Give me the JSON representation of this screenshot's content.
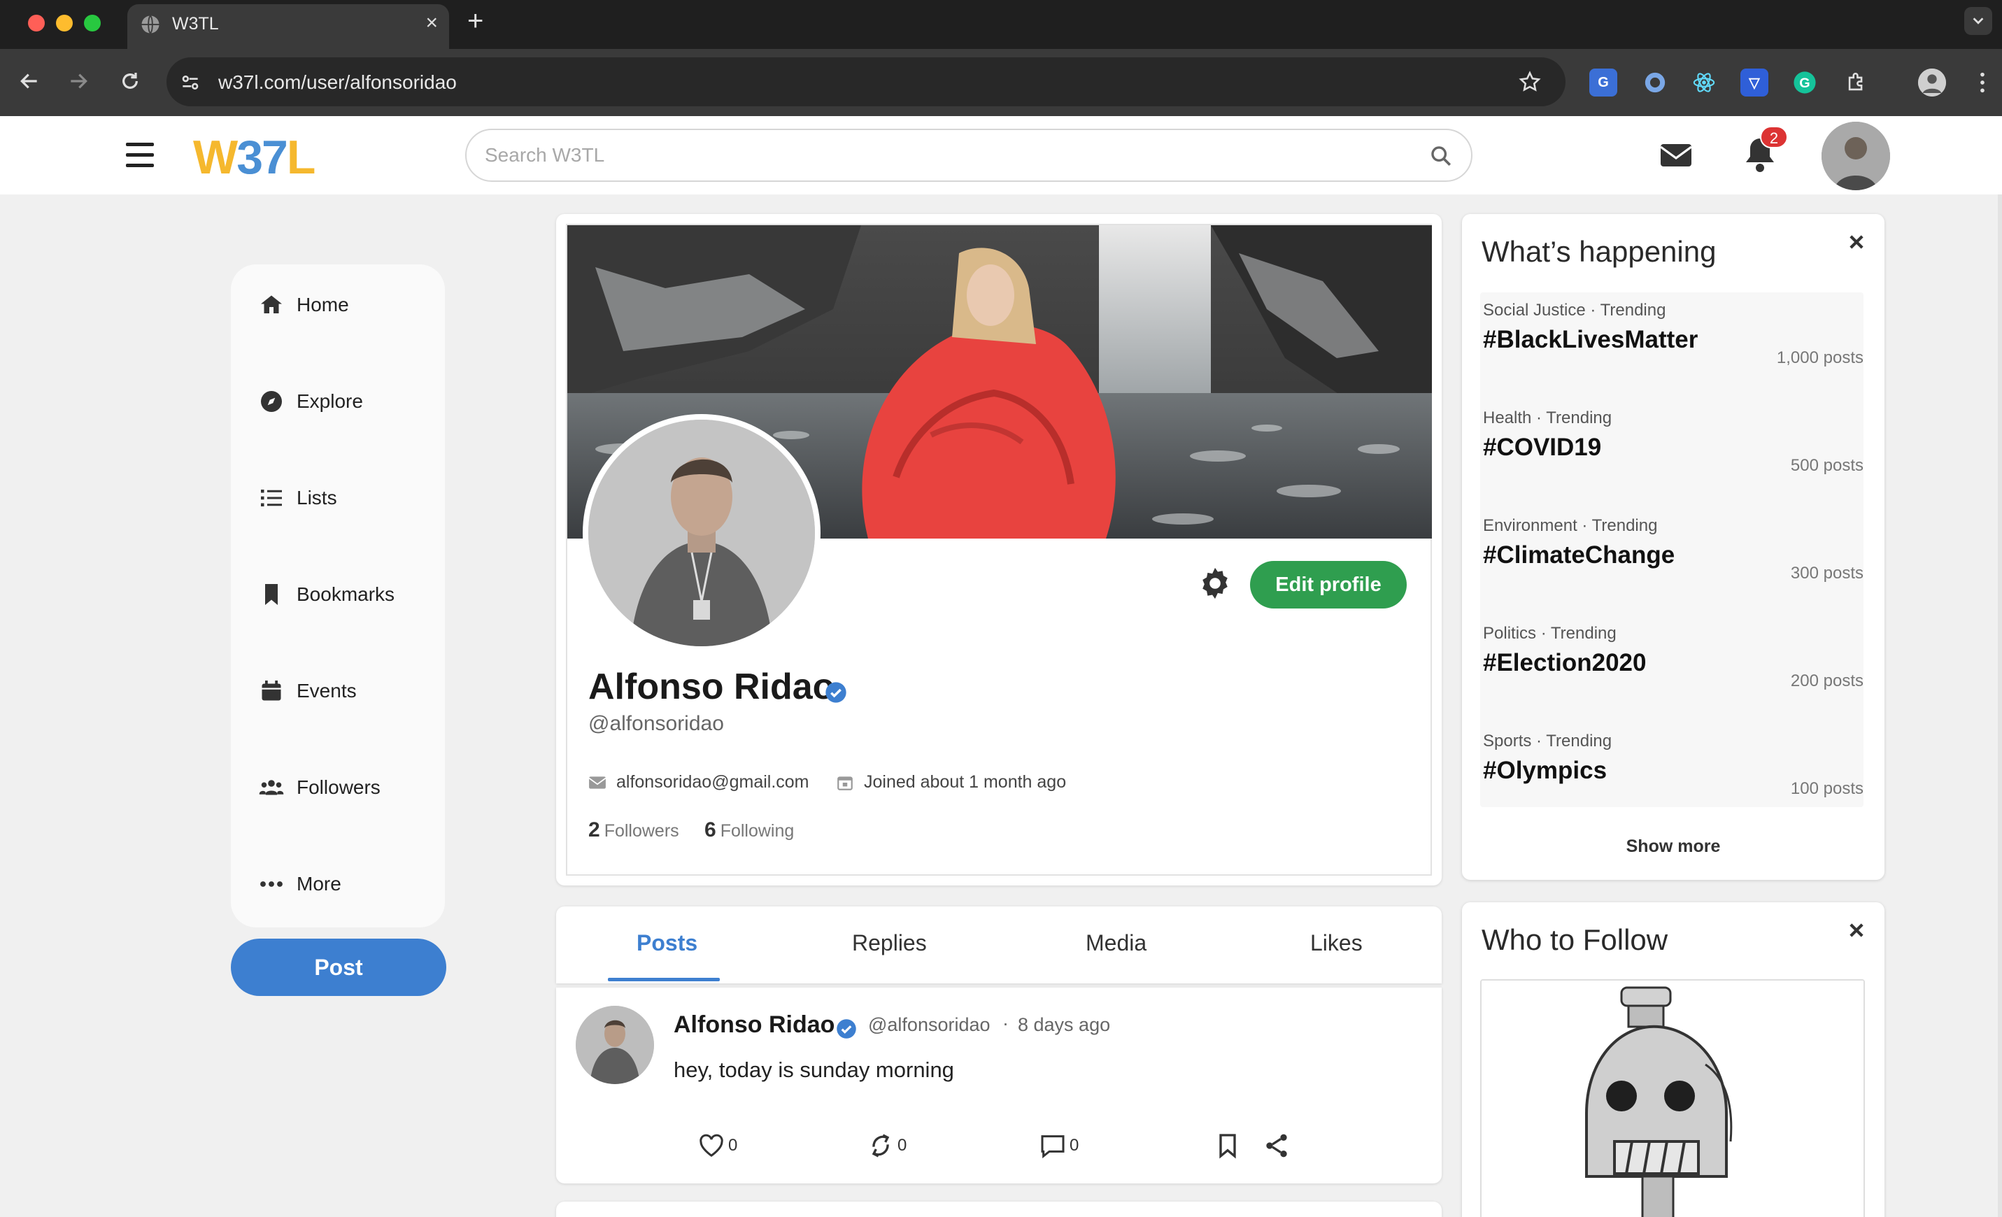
{
  "browser": {
    "tab_title": "W3TL",
    "url": "w37l.com/user/alfonsoridao"
  },
  "header": {
    "logo_w": "W",
    "logo_3": "37",
    "logo_l": "L",
    "search_placeholder": "Search W3TL",
    "notification_count": "2"
  },
  "sidebar": {
    "items": [
      {
        "label": "Home",
        "icon": "home-icon"
      },
      {
        "label": "Explore",
        "icon": "compass-icon"
      },
      {
        "label": "Lists",
        "icon": "list-icon"
      },
      {
        "label": "Bookmarks",
        "icon": "bookmark-icon"
      },
      {
        "label": "Events",
        "icon": "calendar-icon"
      },
      {
        "label": "Followers",
        "icon": "users-icon"
      },
      {
        "label": "More",
        "icon": "more-icon"
      }
    ],
    "post_label": "Post"
  },
  "profile": {
    "name": "Alfonso Ridao",
    "handle": "@alfonsoridao",
    "email": "alfonsoridao@gmail.com",
    "joined": "Joined about 1 month ago",
    "followers_count": "2",
    "followers_label": "Followers",
    "following_count": "6",
    "following_label": "Following",
    "edit_label": "Edit profile"
  },
  "tabs": [
    "Posts",
    "Replies",
    "Media",
    "Likes"
  ],
  "post": {
    "name": "Alfonso Ridao",
    "handle": "@alfonsoridao",
    "separator": "·",
    "time": "8 days ago",
    "text": "hey, today is sunday morning",
    "likes": "0",
    "reposts": "0",
    "comments": "0"
  },
  "trending": {
    "title": "What’s happening",
    "items": [
      {
        "category": "Social Justice · Trending",
        "tag": "#BlackLivesMatter",
        "count": "1,000 posts"
      },
      {
        "category": "Health · Trending",
        "tag": "#COVID19",
        "count": "500 posts"
      },
      {
        "category": "Environment · Trending",
        "tag": "#ClimateChange",
        "count": "300 posts"
      },
      {
        "category": "Politics · Trending",
        "tag": "#Election2020",
        "count": "200 posts"
      },
      {
        "category": "Sports · Trending",
        "tag": "#Olympics",
        "count": "100 posts"
      }
    ],
    "show_more": "Show more"
  },
  "follow": {
    "title": "Who to Follow"
  },
  "colors": {
    "accent": "#3d7fd0",
    "edit_button": "#2f9e4f",
    "logo_yellow": "#f5b82e",
    "badge_red": "#dc3333"
  }
}
